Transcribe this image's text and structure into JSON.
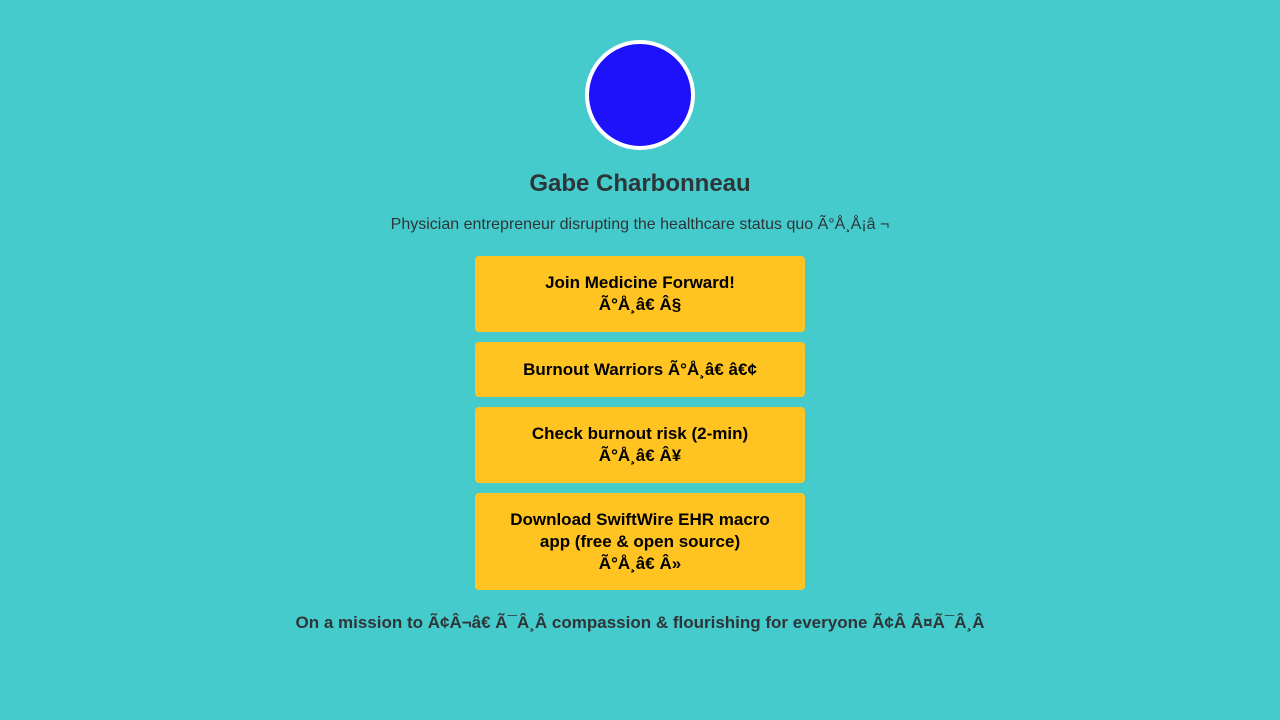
{
  "profile": {
    "avatar_color": "#1d12fb",
    "name": "Gabe Charbonneau",
    "bio": "Physician entrepreneur disrupting the healthcare status quo Ã°Å¸Å¡â ¬"
  },
  "links": [
    {
      "label": "Join Medicine Forward!\nÃ°Å¸â€ Â§"
    },
    {
      "label": "Burnout Warriors Ã°Å¸â€ â€¢"
    },
    {
      "label": "Check burnout risk (2-min)\nÃ°Å¸â€ Â¥"
    },
    {
      "label": "Download SwiftWire EHR macro app (free & open source)\nÃ°Å¸â€ Â»"
    }
  ],
  "footer": {
    "mission": "On a mission to Ã¢Â¬â€ Ã¯Â¸Â  compassion & flourishing for everyone Ã¢Â Â¤Ã¯Â¸Â"
  },
  "colors": {
    "background": "#46cbcc",
    "button": "#ffc421",
    "text": "#2e3538"
  }
}
